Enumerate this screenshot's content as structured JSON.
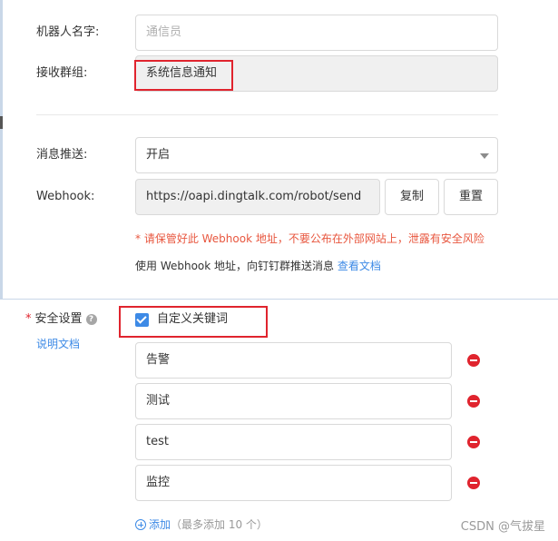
{
  "robot_form": {
    "name_label": "机器人名字:",
    "name_placeholder": "通信员",
    "group_label": "接收群组:",
    "group_value": "系统信息通知",
    "push_label": "消息推送:",
    "push_value": "开启",
    "webhook_label": "Webhook:",
    "webhook_value": "https://oapi.dingtalk.com/robot/send",
    "copy_label": "复制",
    "reset_label": "重置",
    "warning_text": "* 请保管好此 Webhook 地址，不要公布在外部网站上，泄露有安全风险",
    "hint_text": "使用 Webhook 地址，向钉钉群推送消息",
    "hint_link": "查看文档"
  },
  "security": {
    "required_mark": "*",
    "label": "安全设置",
    "help_glyph": "?",
    "doc_link": "说明文档",
    "custom_keywords_label": "自定义关键词",
    "custom_keywords_checked": true,
    "keywords": [
      "告警",
      "测试",
      "test",
      "监控"
    ],
    "add_label": "添加",
    "add_note": "（最多添加 10 个）"
  },
  "watermark": "CSDN @气拔星",
  "colors": {
    "accent": "#3d8ae6",
    "danger": "#e0242e",
    "warning_text": "#e8573f"
  }
}
